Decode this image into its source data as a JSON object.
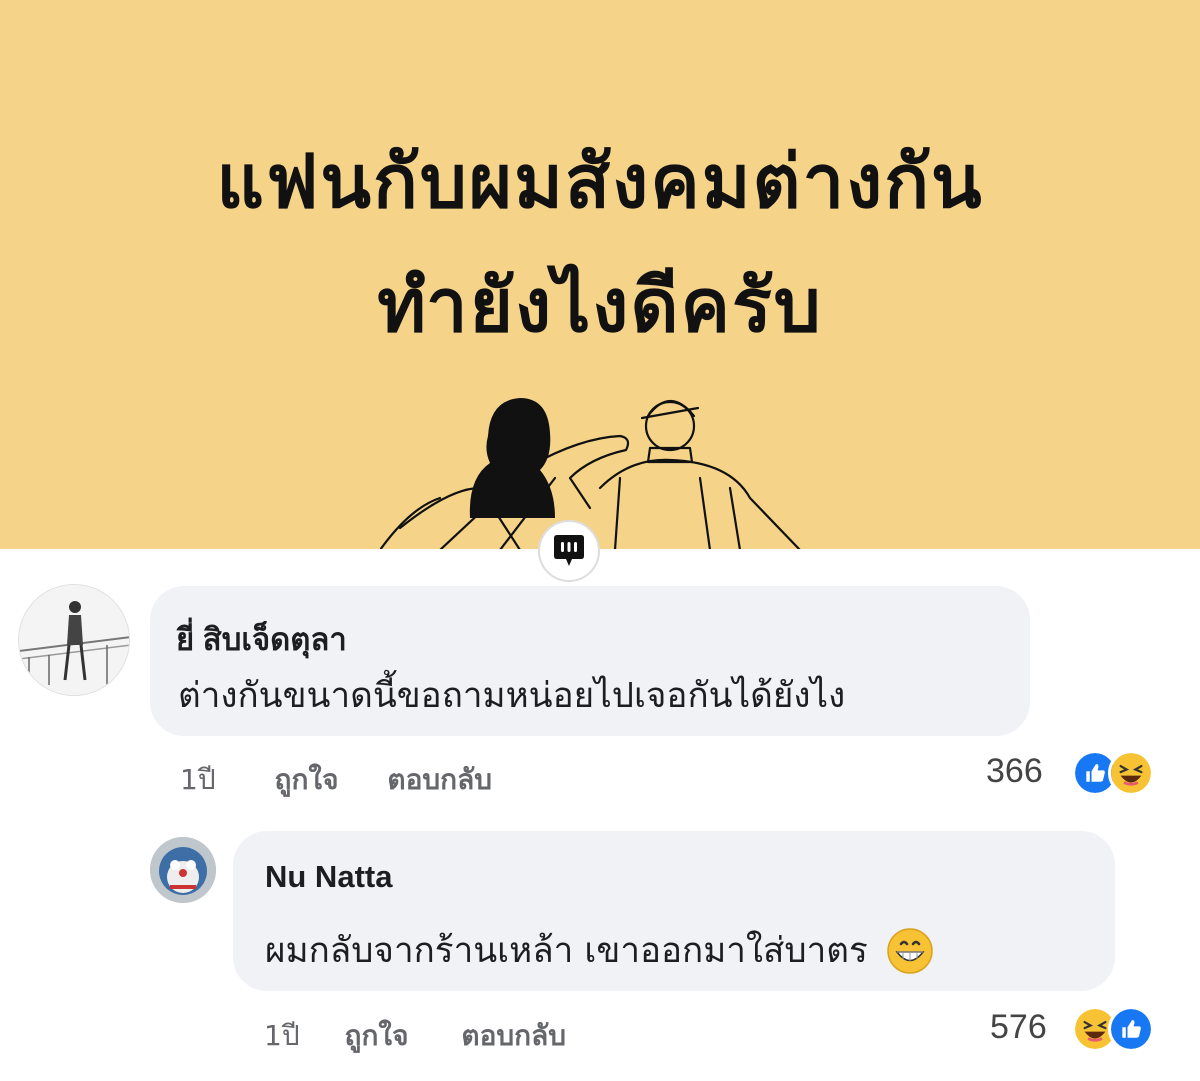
{
  "banner": {
    "title_line1": "แฟนกับผมสังคมต่างกัน",
    "title_line2": "ทำยังไงดีครับ",
    "background_color": "#f5d48a"
  },
  "divider_icon": "comment-bubble-icon",
  "comments": [
    {
      "author": "ยี่ สิบเจ็ดตุลา",
      "text": "ต่างกันขนาดนี้ขอถามหน่อยไปเจอกันได้ยังไง",
      "time": "1ปี",
      "like_label": "ถูกใจ",
      "reply_label": "ตอบกลับ",
      "reaction_count": "366",
      "reactions": [
        "like-icon",
        "haha-icon"
      ]
    },
    {
      "author": "Nu Natta",
      "text": "ผมกลับจากร้านเหล้า เขาออกมาใส่บาตร",
      "inline_emoji": "grinning-face-icon",
      "time": "1ปี",
      "like_label": "ถูกใจ",
      "reply_label": "ตอบกลับ",
      "reaction_count": "576",
      "reactions": [
        "haha-icon",
        "like-icon"
      ]
    }
  ],
  "colors": {
    "bubble": "#f0f2f5",
    "like_blue": "#1877f2",
    "haha_yellow": "#f7c334"
  }
}
